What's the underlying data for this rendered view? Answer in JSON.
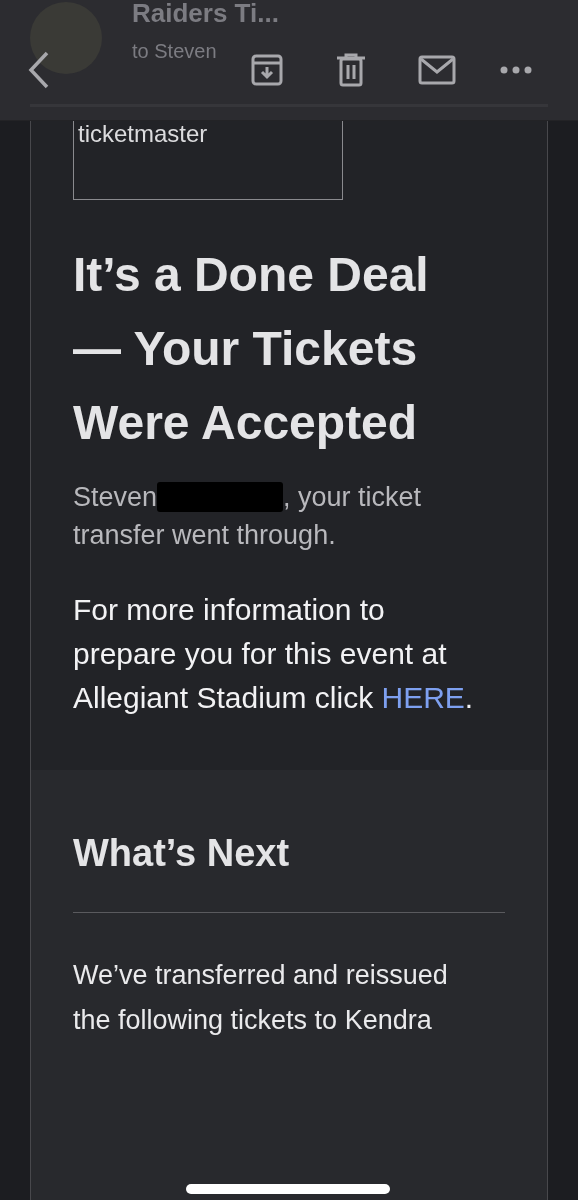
{
  "header": {
    "sender": "Raiders Ti...",
    "recipient": "to Steven"
  },
  "email": {
    "logo_text": "ticketmaster",
    "title": "It’s a Done Deal — Your Tickets Were Accepted",
    "greeting": {
      "name": "Steven",
      "redacted": true,
      "rest": ", your ticket transfer went through."
    },
    "info": {
      "text": "For more information to prepare you for this event at Allegiant Stadium click ",
      "link": "HERE",
      "end": "."
    }
  },
  "next": {
    "heading": "What’s Next",
    "body": "We’ve transferred and reissued the following tickets to Kendra"
  }
}
